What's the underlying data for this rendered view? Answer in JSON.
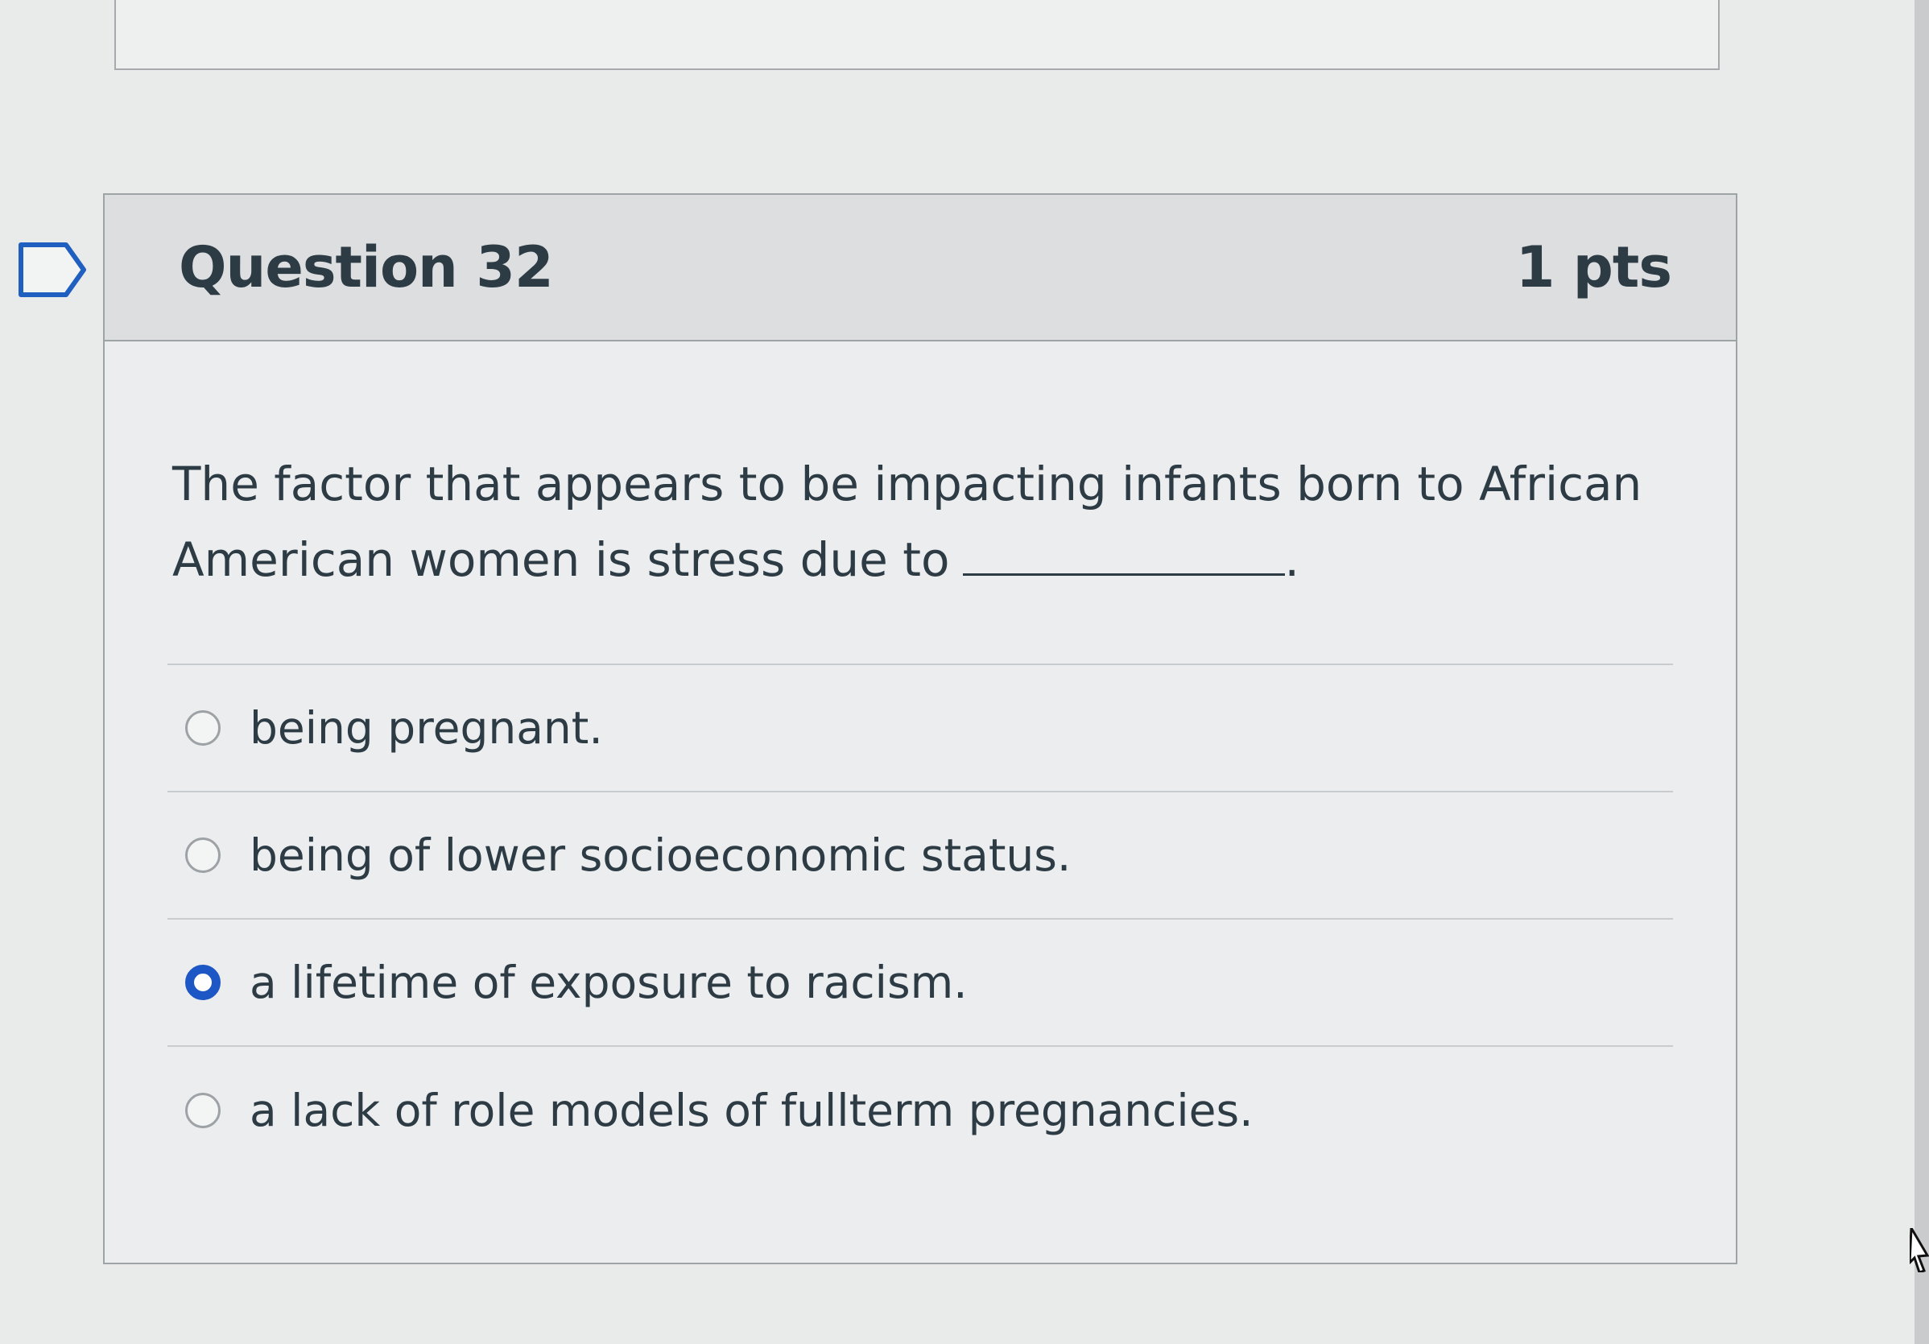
{
  "question": {
    "title": "Question 32",
    "points": "1 pts",
    "stem_before_blank": "The factor that appears to be impacting infants born to African American women is stress due to",
    "stem_after_blank": "."
  },
  "answers": [
    {
      "label": "being pregnant.",
      "selected": false
    },
    {
      "label": "being of lower socioeconomic status.",
      "selected": false
    },
    {
      "label": "a lifetime of exposure to racism.",
      "selected": true
    },
    {
      "label": "a lack of role models of fullterm pregnancies.",
      "selected": false
    }
  ],
  "colors": {
    "selected_radio": "#1d57c5",
    "text": "#2d3b45"
  },
  "icons": {
    "flag": "flag-outline-icon",
    "cursor": "mouse-cursor-icon"
  }
}
